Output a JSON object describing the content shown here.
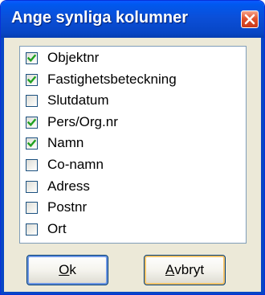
{
  "dialog": {
    "title": "Ange synliga kolumner"
  },
  "columns": [
    {
      "label": "Objektnr",
      "checked": true
    },
    {
      "label": "Fastighetsbeteckning",
      "checked": true
    },
    {
      "label": "Slutdatum",
      "checked": false
    },
    {
      "label": "Pers/Org.nr",
      "checked": true
    },
    {
      "label": "Namn",
      "checked": true
    },
    {
      "label": "Co-namn",
      "checked": false
    },
    {
      "label": "Adress",
      "checked": false
    },
    {
      "label": "Postnr",
      "checked": false
    },
    {
      "label": "Ort",
      "checked": false
    }
  ],
  "buttons": {
    "ok": {
      "accel": "O",
      "rest": "k"
    },
    "cancel": {
      "accel": "A",
      "rest": "vbryt"
    }
  },
  "colors": {
    "title_bar": "#0746c6",
    "close_button": "#e2532d",
    "check_mark": "#21a121",
    "dialog_bg": "#ece9d8"
  }
}
